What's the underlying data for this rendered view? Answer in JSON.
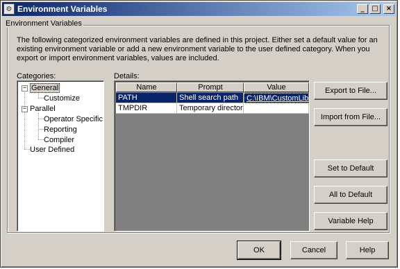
{
  "window": {
    "title": "Environment Variables",
    "buttons": {
      "minimize": "_",
      "maximize": "□",
      "close": "×"
    }
  },
  "group": {
    "title": "Environment Variables",
    "description": "The following categorized environment variables are defined in this project.  Either set a default value for an existing environment variable or add a new environment variable to the user defined category. When you export or import environment variables, values are included."
  },
  "categories": {
    "label": "Categories:",
    "items": [
      {
        "label": "General",
        "expander": "−"
      },
      {
        "label": "Customize"
      },
      {
        "label": "Parallel",
        "expander": "−"
      },
      {
        "label": "Operator Specific"
      },
      {
        "label": "Reporting"
      },
      {
        "label": "Compiler"
      },
      {
        "label": "User Defined"
      }
    ]
  },
  "details": {
    "label": "Details:",
    "columns": [
      "Name",
      "Prompt",
      "Value"
    ],
    "rows": [
      {
        "name": "PATH",
        "prompt": "Shell search path",
        "value": "C:\\IBM\\CustomLib"
      },
      {
        "name": "TMPDIR",
        "prompt": "Temporary directory",
        "value": ""
      }
    ]
  },
  "side_buttons": {
    "export": "Export to File...",
    "import": "Import from File...",
    "set_default": "Set to Default",
    "all_default": "All to Default",
    "variable_help": "Variable Help"
  },
  "footer_buttons": {
    "ok": "OK",
    "cancel": "Cancel",
    "help": "Help"
  }
}
